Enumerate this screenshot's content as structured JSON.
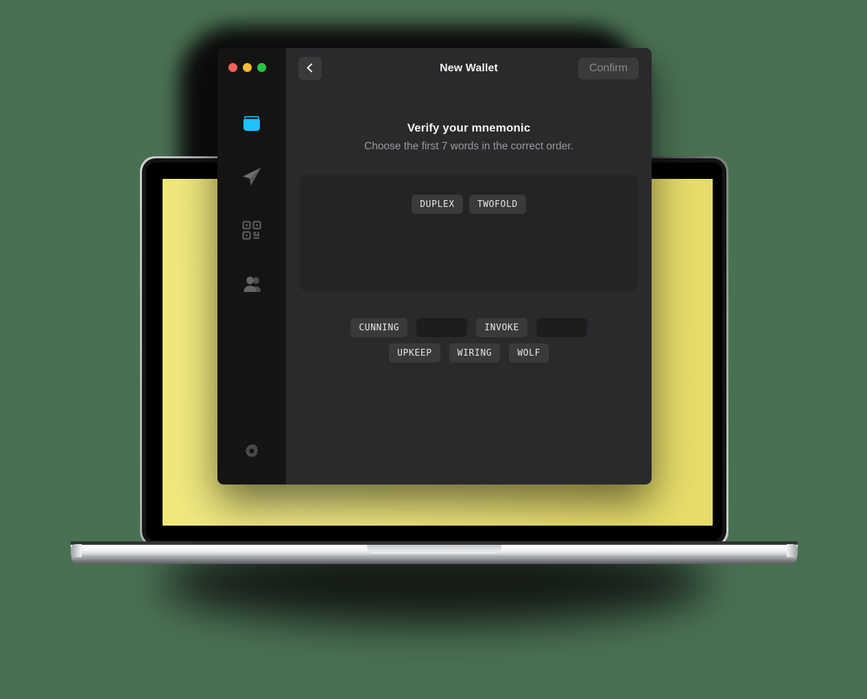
{
  "scene": {
    "background_color": "#4a7052",
    "device": "laptop",
    "wallpaper_color": "#efe87c"
  },
  "app": {
    "window_controls": [
      {
        "name": "close",
        "color": "#ff5f57"
      },
      {
        "name": "minimize",
        "color": "#febc2e"
      },
      {
        "name": "zoom",
        "color": "#28c840"
      }
    ],
    "titlebar": {
      "title": "New Wallet",
      "back_label": "‹",
      "back_icon": "chevron-left-icon",
      "confirm_label": "Confirm",
      "confirm_disabled": true
    },
    "sidebar": {
      "items": [
        {
          "id": "wallet",
          "icon": "wallet-icon",
          "label": "Wallet",
          "active": true,
          "color": "#19c3fb"
        },
        {
          "id": "send",
          "icon": "send-paper-plane-icon",
          "label": "Send",
          "active": false,
          "color": "#6e6e70"
        },
        {
          "id": "receive",
          "icon": "qr-code-icon",
          "label": "Receive",
          "active": false,
          "color": "#5c5c5e"
        },
        {
          "id": "contacts",
          "icon": "contacts-people-icon",
          "label": "Contacts",
          "active": false,
          "color": "#5c5c5e"
        }
      ],
      "bottom_items": [
        {
          "id": "settings",
          "icon": "gear-icon",
          "label": "Settings",
          "active": false,
          "color": "#4a4a4c"
        }
      ]
    },
    "content": {
      "heading": "Verify your mnemonic",
      "subheading": "Choose the first 7 words in the correct order.",
      "selected_words": [
        "DUPLEX",
        "TWOFOLD"
      ],
      "pool_items": [
        {
          "word": "CUNNING",
          "empty": false
        },
        {
          "word": "",
          "empty": true
        },
        {
          "word": "INVOKE",
          "empty": false
        },
        {
          "word": "",
          "empty": true
        },
        {
          "word": "UPKEEP",
          "empty": false
        },
        {
          "word": "WIRING",
          "empty": false
        },
        {
          "word": "WOLF",
          "empty": false
        }
      ],
      "required_word_count": 7,
      "selected_count": 2
    },
    "colors": {
      "sidebar_bg": "#151415",
      "content_bg": "#2a2a2d",
      "panel_bg": "#242427",
      "chip_bg": "#3a3a3c",
      "chip_empty_bg": "#1d1d1f",
      "chip_text": "#e9e5e1",
      "accent": "#19c3fb",
      "muted_text": "#9b9b9e"
    }
  }
}
